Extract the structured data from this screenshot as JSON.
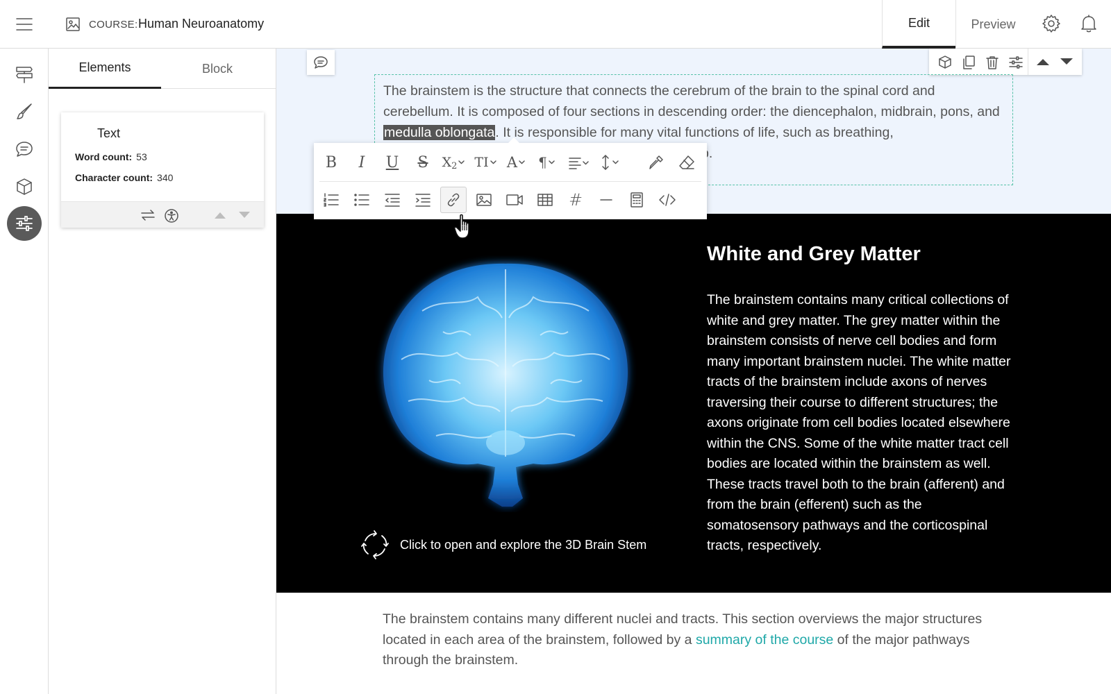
{
  "header": {
    "course_label": "COURSE:",
    "course_title": "Human Neuroanatomy",
    "tab_edit": "Edit",
    "tab_preview": "Preview",
    "icons": [
      "hamburger-icon",
      "course-image-icon",
      "gear-icon",
      "bell-icon"
    ]
  },
  "rail": {
    "icons": [
      "signpost-icon",
      "brush-icon",
      "chat-icon",
      "cube-icon",
      "sliders-icon"
    ],
    "active": "sliders-icon"
  },
  "panel": {
    "tabs": [
      "Elements",
      "Block"
    ],
    "active_tab": "Elements",
    "card": {
      "title": "Text",
      "word_count_label": "Word count:",
      "word_count": "53",
      "char_count_label": "Character count:",
      "char_count": "340"
    }
  },
  "content": {
    "top_text_before": "The brainstem is the structure that connects the cerebrum of the brain to the spinal cord and cerebellum. It is composed of four sections in descending order: the diencephalon, midbrain, pons, and ",
    "top_text_highlight": "medulla oblongata",
    "top_text_after": ". It is responsible for many vital functions of life, such as breathing,",
    "top_text_tail": "p.",
    "dark_title": "White and Grey Matter",
    "dark_body": "The brainstem contains many critical collections of white and grey matter. The grey matter within the brainstem consists of nerve cell bodies and form many important brainstem nuclei. The white matter tracts of the brainstem include axons of nerves traversing their course to different structures; the axons originate from cell bodies located elsewhere within the CNS. Some of the white matter tract cell bodies are located within the brainstem as well. These tracts travel both to the brain (afferent) and from the brain (efferent) such as the somatosensory pathways and the corticospinal tracts, respectively.",
    "explore_label": "Click to open and explore the 3D Brain Stem",
    "bottom_before": "The brainstem contains many different nuclei and tracts. This section overviews the major structures located in each area of the brainstem, followed by a ",
    "bottom_link": "summary of the course",
    "bottom_after": " of the major pathways through the brainstem."
  },
  "format_toolbar": {
    "row1": [
      "bold-icon",
      "italic-icon",
      "underline-icon",
      "strikethrough-icon",
      "subscript-icon",
      "text-size-icon",
      "font-icon",
      "paragraph-icon",
      "align-icon",
      "line-height-icon",
      "color-picker-icon",
      "eraser-icon"
    ],
    "row2": [
      "ordered-list-icon",
      "bullet-list-icon",
      "outdent-icon",
      "indent-icon",
      "link-icon",
      "image-icon",
      "video-icon",
      "table-icon",
      "hashtag-icon",
      "horizontal-rule-icon",
      "calculator-icon",
      "code-icon"
    ],
    "active": "link-icon",
    "glyphs": {
      "bold": "B",
      "italic": "I",
      "underline": "U",
      "strike": "S",
      "sub_base": "X",
      "sub_index": "2",
      "text_size": "TI",
      "font": "A",
      "paragraph": "¶",
      "hash": "#"
    }
  },
  "colors": {
    "accent_link": "#1fa8a8",
    "dashed_border": "#56c2a8",
    "dark_block": "#000000",
    "top_block": "#eef4fd"
  }
}
